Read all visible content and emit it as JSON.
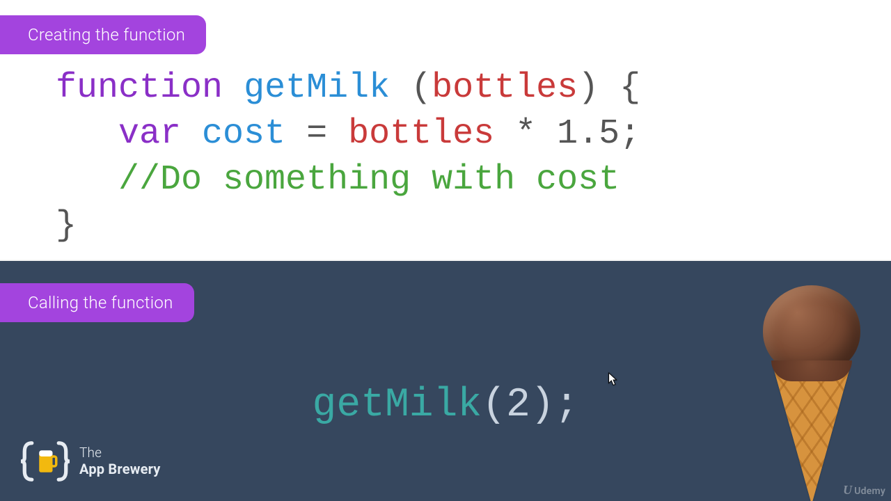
{
  "labels": {
    "top_badge": "Creating the function",
    "bottom_badge": "Calling the function"
  },
  "code": {
    "kw_function": "function",
    "fn_name": "getMilk",
    "paren_open": " (",
    "param": "bottles",
    "paren_close_brace": ") {",
    "indent": "   ",
    "kw_var": "var",
    "ident_cost": " cost",
    "assign": " = ",
    "ident_bottles": "bottles",
    "mul_lit": " * 1.5;",
    "comment": "//Do something with cost",
    "brace_close": "}"
  },
  "call": {
    "fn": "getMilk",
    "open": "(",
    "arg": "2",
    "close_semi": ");"
  },
  "brewery": {
    "line1": "The",
    "line2": "App Brewery"
  },
  "watermark": {
    "brand": "Udemy"
  }
}
